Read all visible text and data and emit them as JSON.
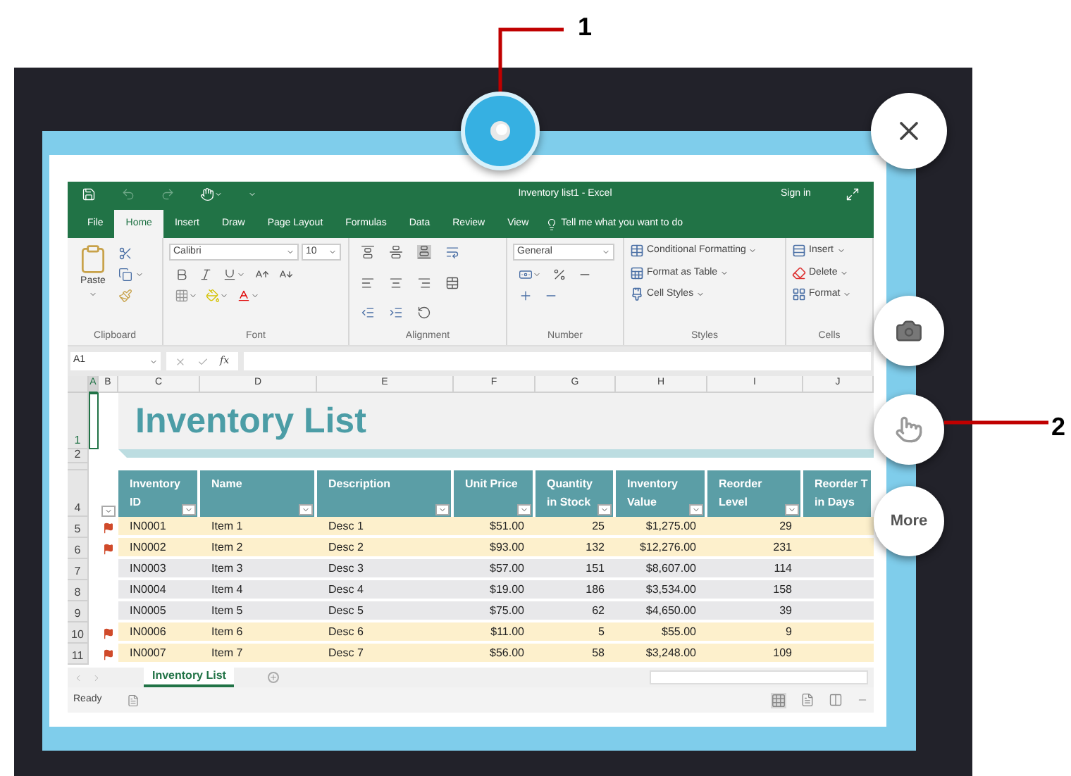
{
  "callouts": [
    {
      "label": "1"
    },
    {
      "label": "2"
    }
  ],
  "more_button": "More",
  "excel": {
    "title": "Inventory list1 - Excel",
    "sign_in": "Sign in",
    "tabs": [
      {
        "label": "File",
        "selected": false
      },
      {
        "label": "Home",
        "selected": true
      },
      {
        "label": "Insert",
        "selected": false
      },
      {
        "label": "Draw",
        "selected": false
      },
      {
        "label": "Page Layout",
        "selected": false
      },
      {
        "label": "Formulas",
        "selected": false
      },
      {
        "label": "Data",
        "selected": false
      },
      {
        "label": "Review",
        "selected": false
      },
      {
        "label": "View",
        "selected": false
      }
    ],
    "tell_me": "Tell me what you want to do",
    "clipboard": {
      "paste": "Paste",
      "label": "Clipboard"
    },
    "font": {
      "name": "Calibri",
      "size": "10",
      "label": "Font"
    },
    "alignment": {
      "label": "Alignment"
    },
    "number": {
      "format": "General",
      "label": "Number"
    },
    "styles": {
      "items": [
        "Conditional Formatting",
        "Format as Table",
        "Cell Styles"
      ],
      "label": "Styles"
    },
    "cells": {
      "items": [
        "Insert",
        "Delete",
        "Format"
      ],
      "label": "Cells"
    },
    "name_box": "A1",
    "fx": "fx",
    "column_letters": [
      {
        "letter": "A",
        "selected": true
      },
      {
        "letter": "B",
        "selected": false
      },
      {
        "letter": "C",
        "selected": false
      },
      {
        "letter": "D",
        "selected": false
      },
      {
        "letter": "E",
        "selected": false
      },
      {
        "letter": "F",
        "selected": false
      },
      {
        "letter": "G",
        "selected": false
      },
      {
        "letter": "H",
        "selected": false
      },
      {
        "letter": "I",
        "selected": false
      },
      {
        "letter": "J",
        "selected": false
      }
    ],
    "title_rows": [
      {
        "number": "1",
        "selected": true
      },
      {
        "number": "2",
        "selected": false
      }
    ],
    "sheet_title": "Inventory List",
    "header_row_number": "4",
    "headers": [
      {
        "lines": [
          "Inventory",
          "ID"
        ]
      },
      {
        "lines": [
          "Name"
        ]
      },
      {
        "lines": [
          "Description"
        ]
      },
      {
        "lines": [
          "Unit Price"
        ]
      },
      {
        "lines": [
          "Quantity",
          "in Stock"
        ]
      },
      {
        "lines": [
          "Inventory",
          "Value"
        ]
      },
      {
        "lines": [
          "Reorder",
          "Level"
        ]
      },
      {
        "lines": [
          "Reorder T",
          "in Days"
        ]
      }
    ],
    "rows": [
      {
        "number": "5",
        "flagged": true,
        "cells": [
          "IN0001",
          "Item 1",
          "Desc 1",
          "$51.00",
          "25",
          "$1,275.00",
          "29"
        ]
      },
      {
        "number": "6",
        "flagged": true,
        "cells": [
          "IN0002",
          "Item 2",
          "Desc 2",
          "$93.00",
          "132",
          "$12,276.00",
          "231"
        ]
      },
      {
        "number": "7",
        "flagged": false,
        "cells": [
          "IN0003",
          "Item 3",
          "Desc 3",
          "$57.00",
          "151",
          "$8,607.00",
          "114"
        ]
      },
      {
        "number": "8",
        "flagged": false,
        "cells": [
          "IN0004",
          "Item 4",
          "Desc 4",
          "$19.00",
          "186",
          "$3,534.00",
          "158"
        ]
      },
      {
        "number": "9",
        "flagged": false,
        "cells": [
          "IN0005",
          "Item 5",
          "Desc 5",
          "$75.00",
          "62",
          "$4,650.00",
          "39"
        ]
      },
      {
        "number": "10",
        "flagged": true,
        "cells": [
          "IN0006",
          "Item 6",
          "Desc 6",
          "$11.00",
          "5",
          "$55.00",
          "9"
        ]
      },
      {
        "number": "11",
        "flagged": true,
        "cells": [
          "IN0007",
          "Item 7",
          "Desc 7",
          "$56.00",
          "58",
          "$3,248.00",
          "109"
        ]
      }
    ],
    "sheet_tab": "Inventory List",
    "status": "Ready"
  }
}
